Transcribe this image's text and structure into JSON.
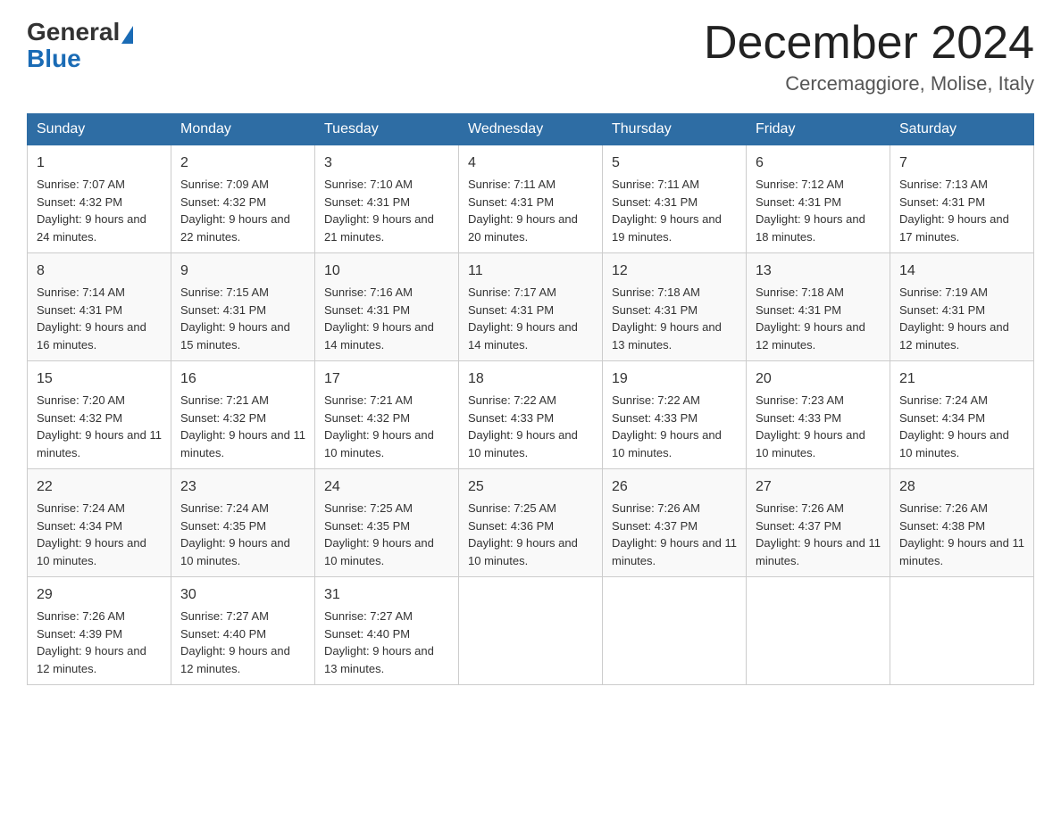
{
  "logo": {
    "text_general": "General",
    "text_blue": "Blue"
  },
  "header": {
    "month_year": "December 2024",
    "location": "Cercemaggiore, Molise, Italy"
  },
  "days_of_week": [
    "Sunday",
    "Monday",
    "Tuesday",
    "Wednesday",
    "Thursday",
    "Friday",
    "Saturday"
  ],
  "weeks": [
    [
      {
        "day": "1",
        "sunrise": "7:07 AM",
        "sunset": "4:32 PM",
        "daylight": "9 hours and 24 minutes."
      },
      {
        "day": "2",
        "sunrise": "7:09 AM",
        "sunset": "4:32 PM",
        "daylight": "9 hours and 22 minutes."
      },
      {
        "day": "3",
        "sunrise": "7:10 AM",
        "sunset": "4:31 PM",
        "daylight": "9 hours and 21 minutes."
      },
      {
        "day": "4",
        "sunrise": "7:11 AM",
        "sunset": "4:31 PM",
        "daylight": "9 hours and 20 minutes."
      },
      {
        "day": "5",
        "sunrise": "7:11 AM",
        "sunset": "4:31 PM",
        "daylight": "9 hours and 19 minutes."
      },
      {
        "day": "6",
        "sunrise": "7:12 AM",
        "sunset": "4:31 PM",
        "daylight": "9 hours and 18 minutes."
      },
      {
        "day": "7",
        "sunrise": "7:13 AM",
        "sunset": "4:31 PM",
        "daylight": "9 hours and 17 minutes."
      }
    ],
    [
      {
        "day": "8",
        "sunrise": "7:14 AM",
        "sunset": "4:31 PM",
        "daylight": "9 hours and 16 minutes."
      },
      {
        "day": "9",
        "sunrise": "7:15 AM",
        "sunset": "4:31 PM",
        "daylight": "9 hours and 15 minutes."
      },
      {
        "day": "10",
        "sunrise": "7:16 AM",
        "sunset": "4:31 PM",
        "daylight": "9 hours and 14 minutes."
      },
      {
        "day": "11",
        "sunrise": "7:17 AM",
        "sunset": "4:31 PM",
        "daylight": "9 hours and 14 minutes."
      },
      {
        "day": "12",
        "sunrise": "7:18 AM",
        "sunset": "4:31 PM",
        "daylight": "9 hours and 13 minutes."
      },
      {
        "day": "13",
        "sunrise": "7:18 AM",
        "sunset": "4:31 PM",
        "daylight": "9 hours and 12 minutes."
      },
      {
        "day": "14",
        "sunrise": "7:19 AM",
        "sunset": "4:31 PM",
        "daylight": "9 hours and 12 minutes."
      }
    ],
    [
      {
        "day": "15",
        "sunrise": "7:20 AM",
        "sunset": "4:32 PM",
        "daylight": "9 hours and 11 minutes."
      },
      {
        "day": "16",
        "sunrise": "7:21 AM",
        "sunset": "4:32 PM",
        "daylight": "9 hours and 11 minutes."
      },
      {
        "day": "17",
        "sunrise": "7:21 AM",
        "sunset": "4:32 PM",
        "daylight": "9 hours and 10 minutes."
      },
      {
        "day": "18",
        "sunrise": "7:22 AM",
        "sunset": "4:33 PM",
        "daylight": "9 hours and 10 minutes."
      },
      {
        "day": "19",
        "sunrise": "7:22 AM",
        "sunset": "4:33 PM",
        "daylight": "9 hours and 10 minutes."
      },
      {
        "day": "20",
        "sunrise": "7:23 AM",
        "sunset": "4:33 PM",
        "daylight": "9 hours and 10 minutes."
      },
      {
        "day": "21",
        "sunrise": "7:24 AM",
        "sunset": "4:34 PM",
        "daylight": "9 hours and 10 minutes."
      }
    ],
    [
      {
        "day": "22",
        "sunrise": "7:24 AM",
        "sunset": "4:34 PM",
        "daylight": "9 hours and 10 minutes."
      },
      {
        "day": "23",
        "sunrise": "7:24 AM",
        "sunset": "4:35 PM",
        "daylight": "9 hours and 10 minutes."
      },
      {
        "day": "24",
        "sunrise": "7:25 AM",
        "sunset": "4:35 PM",
        "daylight": "9 hours and 10 minutes."
      },
      {
        "day": "25",
        "sunrise": "7:25 AM",
        "sunset": "4:36 PM",
        "daylight": "9 hours and 10 minutes."
      },
      {
        "day": "26",
        "sunrise": "7:26 AM",
        "sunset": "4:37 PM",
        "daylight": "9 hours and 11 minutes."
      },
      {
        "day": "27",
        "sunrise": "7:26 AM",
        "sunset": "4:37 PM",
        "daylight": "9 hours and 11 minutes."
      },
      {
        "day": "28",
        "sunrise": "7:26 AM",
        "sunset": "4:38 PM",
        "daylight": "9 hours and 11 minutes."
      }
    ],
    [
      {
        "day": "29",
        "sunrise": "7:26 AM",
        "sunset": "4:39 PM",
        "daylight": "9 hours and 12 minutes."
      },
      {
        "day": "30",
        "sunrise": "7:27 AM",
        "sunset": "4:40 PM",
        "daylight": "9 hours and 12 minutes."
      },
      {
        "day": "31",
        "sunrise": "7:27 AM",
        "sunset": "4:40 PM",
        "daylight": "9 hours and 13 minutes."
      },
      null,
      null,
      null,
      null
    ]
  ],
  "labels": {
    "sunrise": "Sunrise:",
    "sunset": "Sunset:",
    "daylight": "Daylight:"
  }
}
